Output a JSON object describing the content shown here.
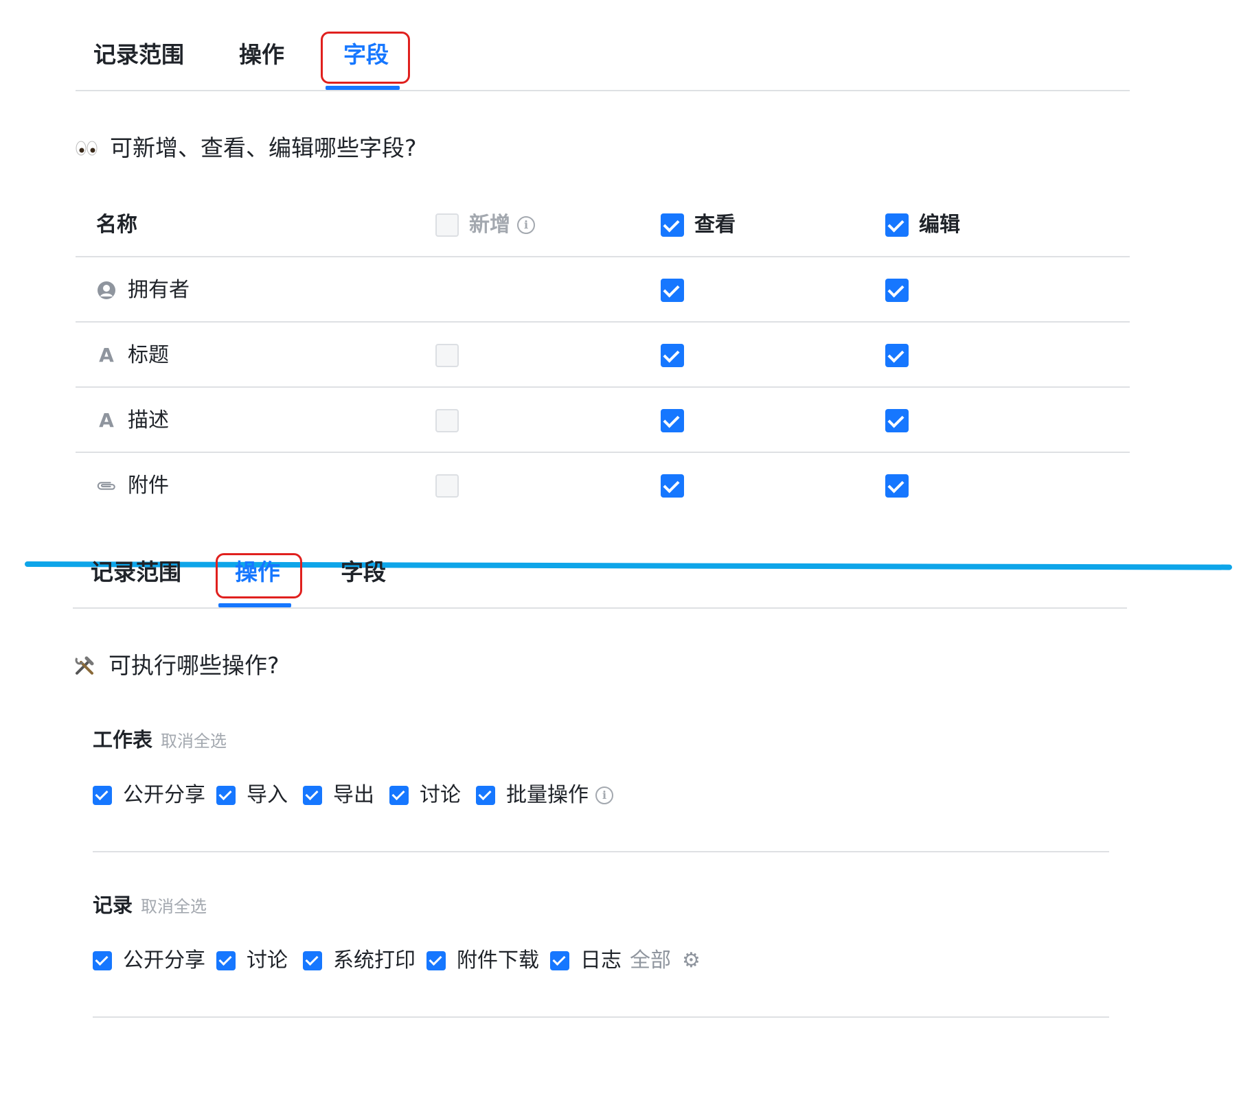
{
  "panel1": {
    "tabs": [
      "记录范围",
      "操作",
      "字段"
    ],
    "active_tab": "字段",
    "question": "可新增、查看、编辑哪些字段?",
    "question_icon": "eyes-emoji",
    "columns": {
      "name": "名称",
      "add": "新增",
      "view": "查看",
      "edit": "编辑"
    },
    "header_checks": {
      "add": false,
      "view": true,
      "edit": true
    },
    "rows": [
      {
        "icon": "person-circle-icon",
        "label": "拥有者",
        "add": null,
        "view": true,
        "edit": true
      },
      {
        "icon": "text-type-icon",
        "label": "标题",
        "add": false,
        "view": true,
        "edit": true
      },
      {
        "icon": "text-type-icon",
        "label": "描述",
        "add": false,
        "view": true,
        "edit": true
      },
      {
        "icon": "paperclip-icon",
        "label": "附件",
        "add": false,
        "view": true,
        "edit": true
      }
    ]
  },
  "panel2": {
    "tabs": [
      "记录范围",
      "操作",
      "字段"
    ],
    "active_tab": "操作",
    "question": "可执行哪些操作?",
    "question_icon": "tools-emoji",
    "groups": [
      {
        "title": "工作表",
        "deselect_all": "取消全选",
        "items": [
          {
            "label": "公开分享",
            "checked": true
          },
          {
            "label": "导入",
            "checked": true
          },
          {
            "label": "导出",
            "checked": true
          },
          {
            "label": "讨论",
            "checked": true
          },
          {
            "label": "批量操作",
            "checked": true,
            "info": true
          }
        ]
      },
      {
        "title": "记录",
        "deselect_all": "取消全选",
        "items": [
          {
            "label": "公开分享",
            "checked": true
          },
          {
            "label": "讨论",
            "checked": true
          },
          {
            "label": "系统打印",
            "checked": true
          },
          {
            "label": "附件下载",
            "checked": true
          },
          {
            "label": "日志",
            "checked": true,
            "extra": "全部",
            "gear": true
          }
        ]
      }
    ]
  },
  "colors": {
    "accent": "#1677ff",
    "highlight_box": "#e0201e",
    "section_divider": "#0ea5e9"
  }
}
